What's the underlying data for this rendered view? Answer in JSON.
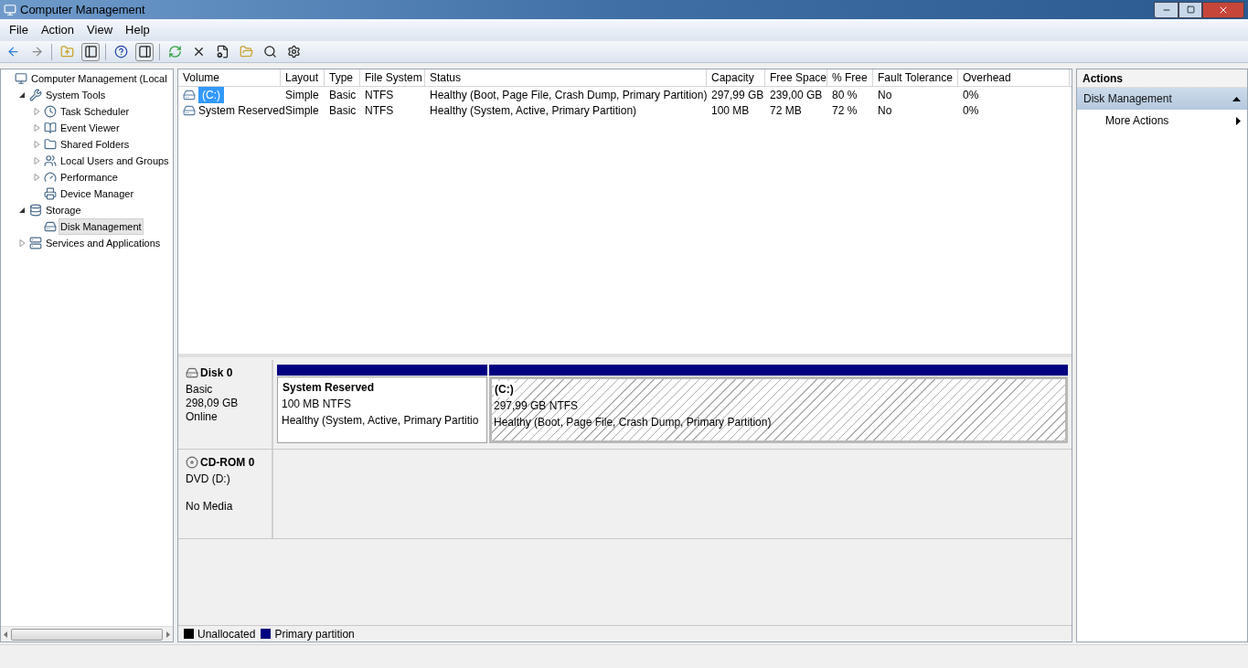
{
  "window": {
    "title": "Computer Management"
  },
  "menu": [
    "File",
    "Action",
    "View",
    "Help"
  ],
  "toolbar": [
    {
      "kind": "back"
    },
    {
      "kind": "forward"
    },
    {
      "kind": "sep"
    },
    {
      "kind": "up"
    },
    {
      "kind": "tree",
      "selected": true
    },
    {
      "kind": "sep"
    },
    {
      "kind": "help"
    },
    {
      "kind": "pane",
      "selected": true
    },
    {
      "kind": "sep"
    },
    {
      "kind": "refresh"
    },
    {
      "kind": "delete"
    },
    {
      "kind": "properties"
    },
    {
      "kind": "open"
    },
    {
      "kind": "search"
    },
    {
      "kind": "settings"
    }
  ],
  "tree": [
    {
      "label": "Computer Management (Local",
      "selected": false,
      "children": [
        {
          "label": "System Tools",
          "expanded": true,
          "selected": false,
          "children": [
            {
              "label": "Task Scheduler",
              "expanded": false,
              "selected": false
            },
            {
              "label": "Event Viewer",
              "expanded": false,
              "selected": false
            },
            {
              "label": "Shared Folders",
              "expanded": false,
              "selected": false
            },
            {
              "label": "Local Users and Groups",
              "expanded": false,
              "selected": false
            },
            {
              "label": "Performance",
              "expanded": false,
              "selected": false
            },
            {
              "label": "Device Manager",
              "selected": false
            }
          ]
        },
        {
          "label": "Storage",
          "expanded": true,
          "selected": false,
          "children": [
            {
              "label": "Disk Management",
              "selected": true
            }
          ]
        },
        {
          "label": "Services and Applications",
          "expanded": false,
          "selected": false
        }
      ]
    }
  ],
  "volumes": {
    "columns": [
      "Volume",
      "Layout",
      "Type",
      "File System",
      "Status",
      "Capacity",
      "Free Space",
      "% Free",
      "Fault Tolerance",
      "Overhead"
    ],
    "rows": [
      {
        "selected": true,
        "cells": [
          "(C:)",
          "Simple",
          "Basic",
          "NTFS",
          "Healthy (Boot, Page File, Crash Dump, Primary Partition)",
          "297,99 GB",
          "239,00 GB",
          "80 %",
          "No",
          "0%"
        ]
      },
      {
        "selected": false,
        "cells": [
          "System Reserved",
          "Simple",
          "Basic",
          "NTFS",
          "Healthy (System, Active, Primary Partition)",
          "100 MB",
          "72 MB",
          "72 %",
          "No",
          "0%"
        ]
      }
    ]
  },
  "disks": [
    {
      "kind": "disk",
      "name": "Disk 0",
      "lines": [
        "Basic",
        "298,09 GB",
        "Online"
      ],
      "partitions": [
        {
          "name": "System Reserved",
          "size": "100 MB NTFS",
          "status": "Healthy (System, Active, Primary Partitio",
          "color": "#000080",
          "selected": false
        },
        {
          "name": "(C:)",
          "size": "297,99 GB NTFS",
          "status": "Healthy (Boot, Page File, Crash Dump, Primary Partition)",
          "color": "#000080",
          "selected": true
        }
      ]
    },
    {
      "kind": "cdrom",
      "name": "CD-ROM 0",
      "lines": [
        "DVD (D:)",
        "No Media"
      ]
    }
  ],
  "legend": [
    {
      "label": "Unallocated",
      "color": "#000000"
    },
    {
      "label": "Primary partition",
      "color": "#000080"
    }
  ],
  "actions": {
    "title": "Actions",
    "section": "Disk Management",
    "expanded": true,
    "items": [
      "More Actions"
    ]
  }
}
